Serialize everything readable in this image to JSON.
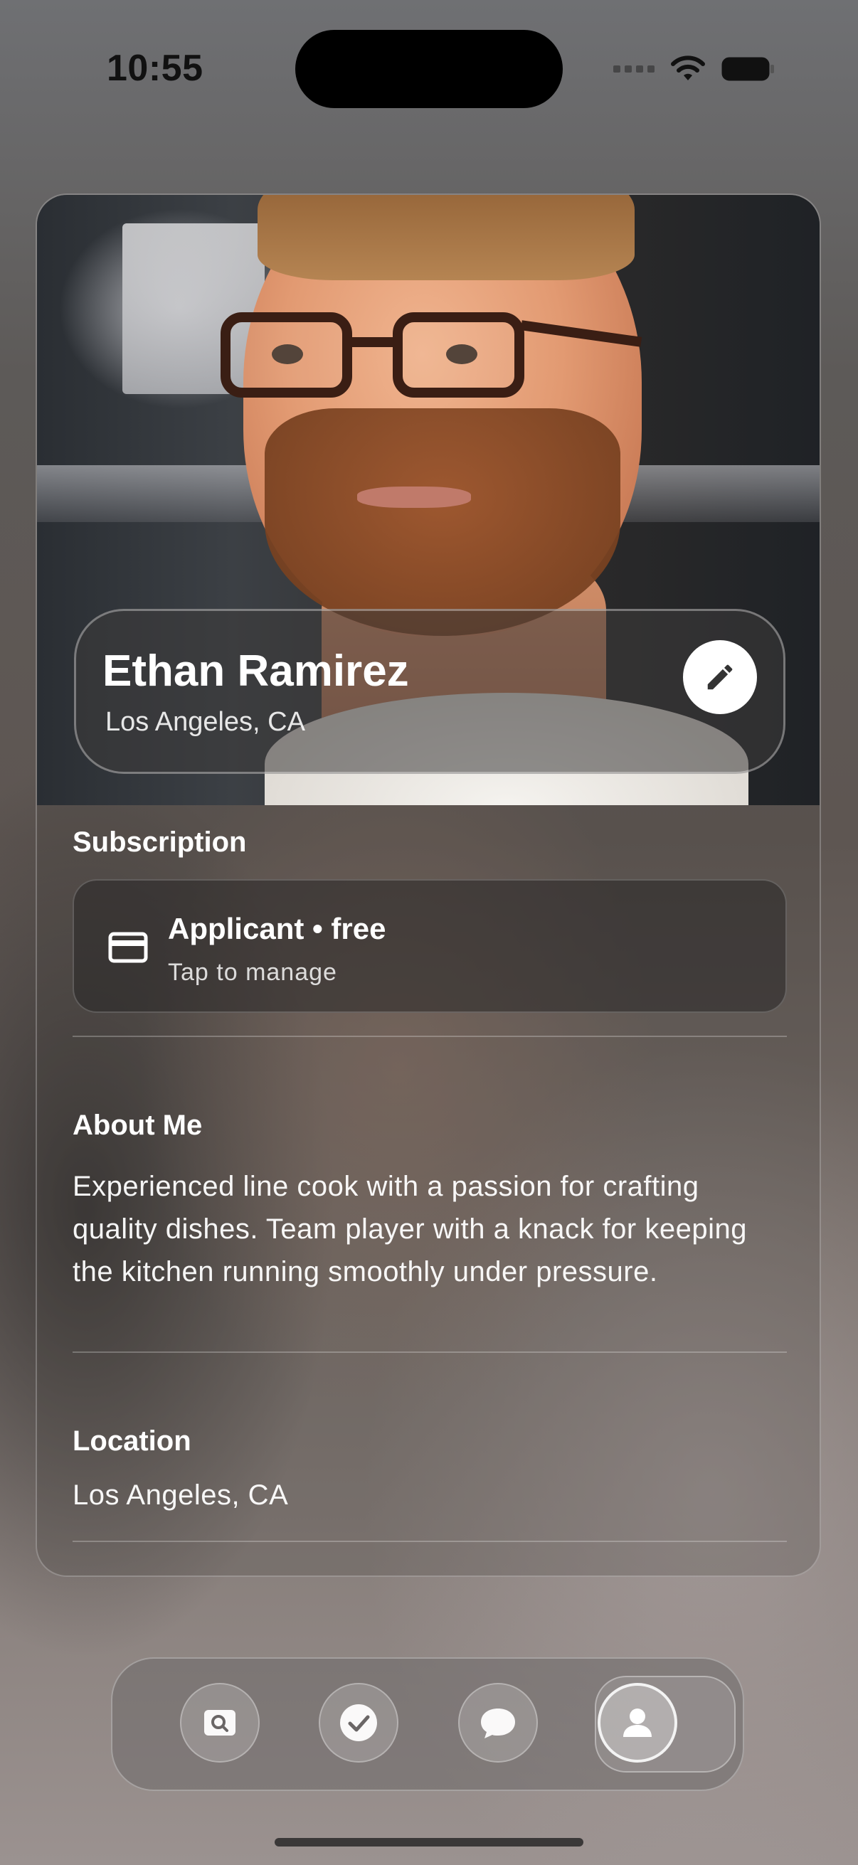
{
  "status_bar": {
    "time": "10:55"
  },
  "profile": {
    "name": "Ethan Ramirez",
    "location": "Los Angeles, CA"
  },
  "subscription": {
    "label": "Subscription",
    "title": "Applicant • free",
    "subtitle": "Tap to manage"
  },
  "about": {
    "label": "About Me",
    "text": "Experienced line cook with a passion for crafting quality dishes. Team player with a knack for keeping the kitchen running smoothly under pressure."
  },
  "location_section": {
    "label": "Location",
    "value": "Los Angeles, CA"
  },
  "tab_bar": {
    "tabs": [
      {
        "icon": "search-icon",
        "selected": false
      },
      {
        "icon": "checkmark-icon",
        "selected": false
      },
      {
        "icon": "chat-bubble-icon",
        "selected": false
      },
      {
        "icon": "person-icon",
        "selected": true
      }
    ]
  },
  "colors": {
    "card_text": "#ffffff",
    "edit_button_bg": "#ffffff",
    "edit_icon": "#333333"
  }
}
